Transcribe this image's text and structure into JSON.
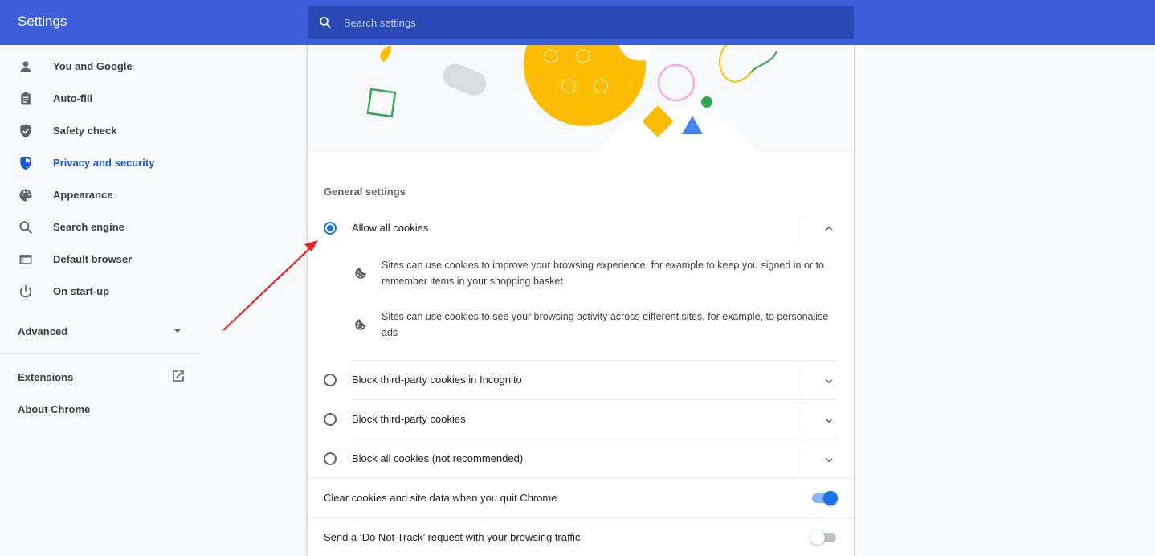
{
  "app": {
    "title": "Settings"
  },
  "search": {
    "placeholder": "Search settings",
    "icon": "search-icon"
  },
  "sidebar": {
    "items": [
      {
        "label": "You and Google",
        "icon": "person-icon"
      },
      {
        "label": "Auto-fill",
        "icon": "clipboard-icon"
      },
      {
        "label": "Safety check",
        "icon": "shield-check-icon"
      },
      {
        "label": "Privacy and security",
        "icon": "shield-icon",
        "active": true
      },
      {
        "label": "Appearance",
        "icon": "palette-icon"
      },
      {
        "label": "Search engine",
        "icon": "search-icon"
      },
      {
        "label": "Default browser",
        "icon": "browser-icon"
      },
      {
        "label": "On start-up",
        "icon": "power-icon"
      }
    ],
    "advanced": {
      "label": "Advanced",
      "icon": "caret-down-icon"
    },
    "extensions": {
      "label": "Extensions",
      "icon": "open-external-icon"
    },
    "about": {
      "label": "About Chrome"
    }
  },
  "main": {
    "section_title": "General settings",
    "cookie_options": [
      {
        "label": "Allow all cookies",
        "selected": true,
        "expanded": true,
        "details": [
          "Sites can use cookies to improve your browsing experience, for example to keep you signed in or to remember items in your shopping basket",
          "Sites can use cookies to see your browsing activity across different sites, for example, to personalise ads"
        ]
      },
      {
        "label": "Block third-party cookies in Incognito",
        "selected": false,
        "expanded": false
      },
      {
        "label": "Block third-party cookies",
        "selected": false,
        "expanded": false
      },
      {
        "label": "Block all cookies (not recommended)",
        "selected": false,
        "expanded": false
      }
    ],
    "toggles": [
      {
        "label": "Clear cookies and site data when you quit Chrome",
        "on": true
      },
      {
        "label": "Send a ‘Do Not Track’ request with your browsing traffic",
        "on": false
      }
    ]
  },
  "colors": {
    "header": "#3e5fdb",
    "search_bg": "#2a48b5",
    "accent": "#1a73e8",
    "active_nav": "#1a56d6",
    "annotation_arrow": "#e8231e"
  }
}
